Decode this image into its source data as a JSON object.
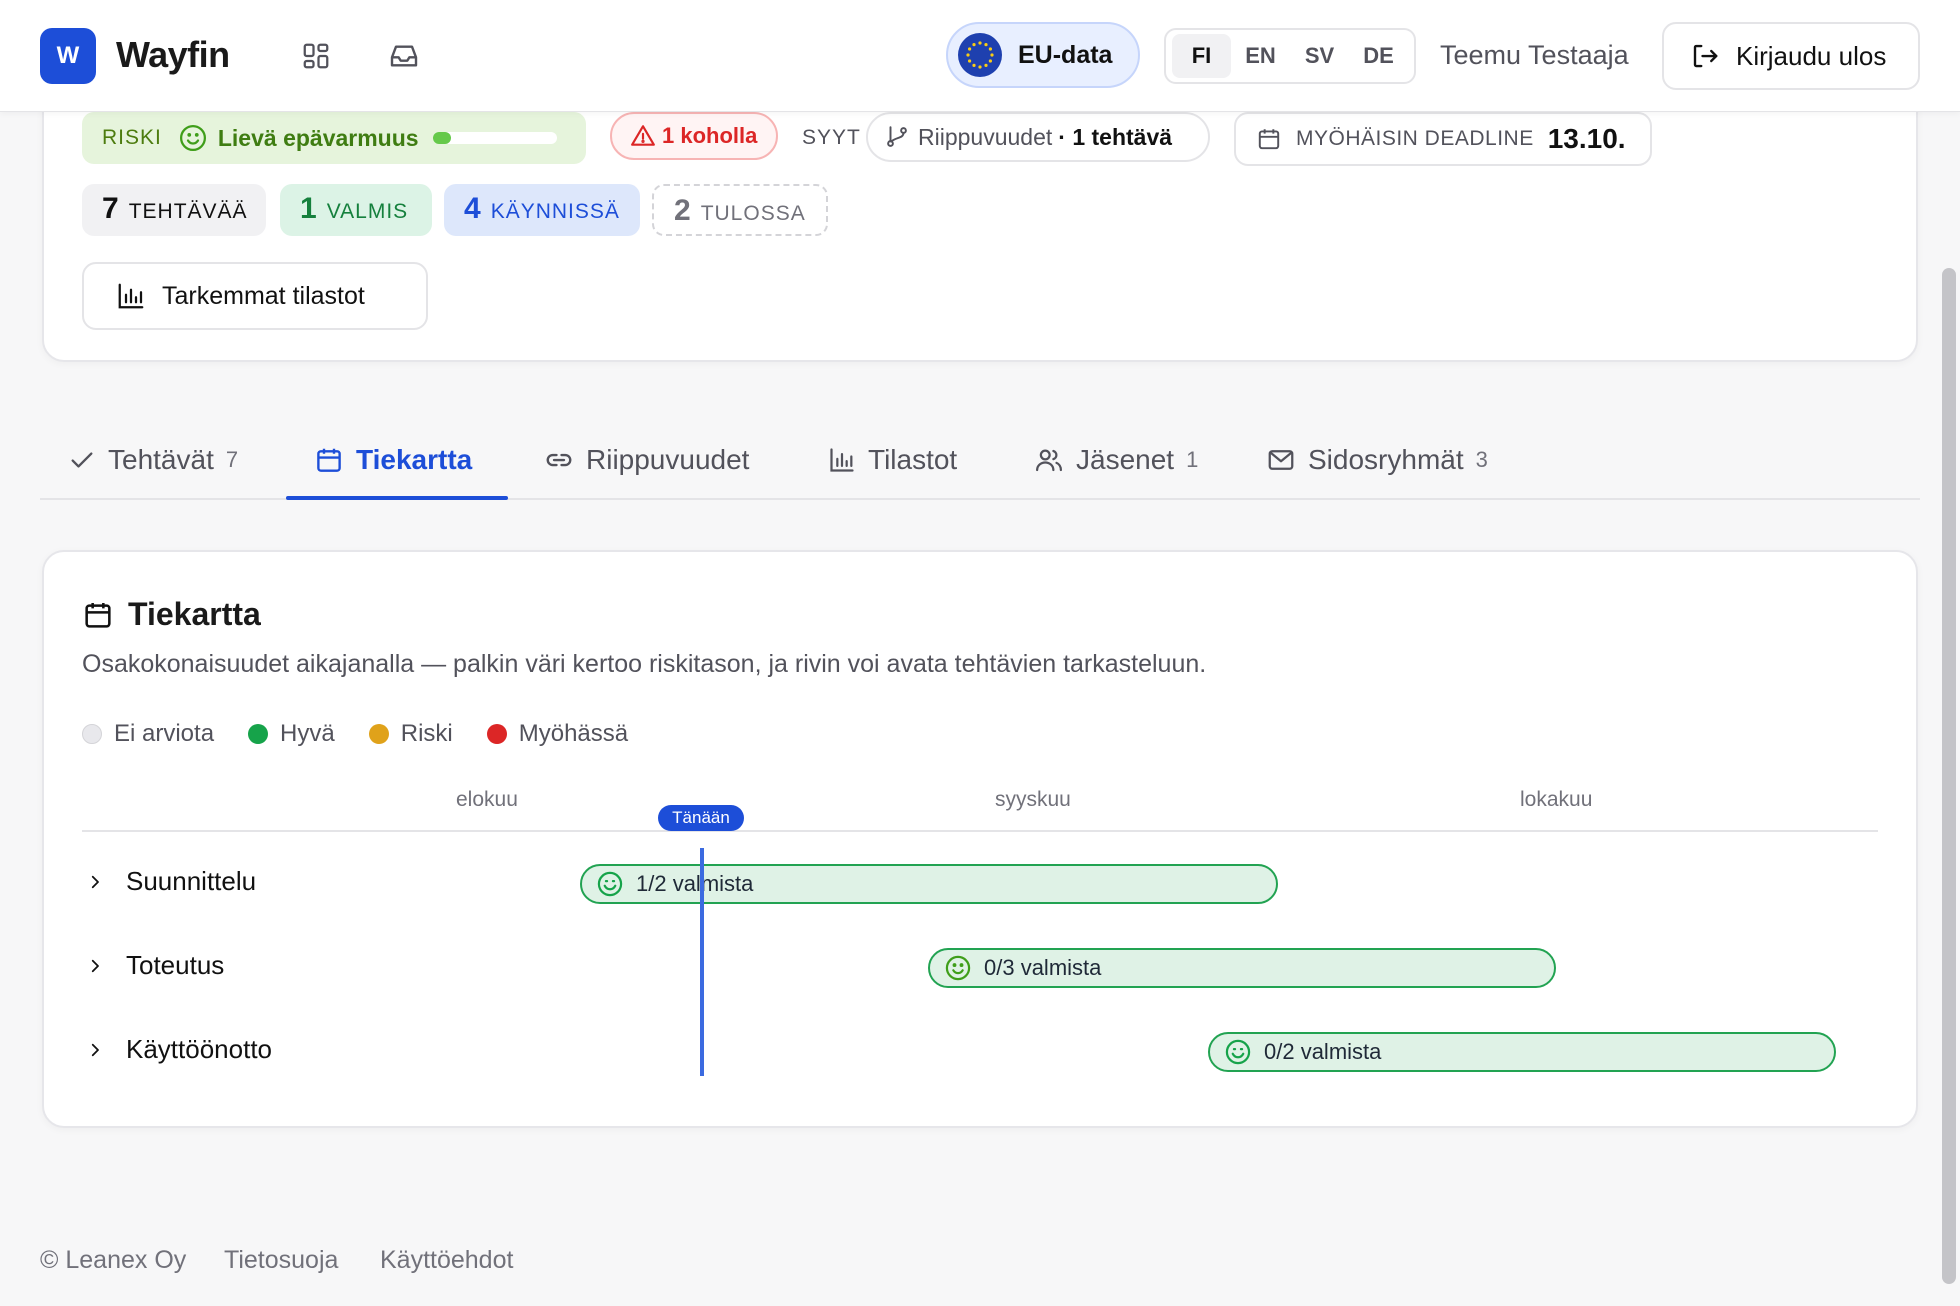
{
  "header": {
    "logo_letter": "W",
    "brand": "Wayfin",
    "icons": [
      "grid-icon",
      "inbox-icon"
    ],
    "eu_badge": "EU-data",
    "languages": [
      "FI",
      "EN",
      "SV",
      "DE"
    ],
    "active_language": "FI",
    "user_name": "Teemu Testaaja",
    "logout_label": "Kirjaudu ulos"
  },
  "summary": {
    "risk_label": "RISKI",
    "risk_text": "Lievä epävarmuus",
    "risk_level_fraction": 0.15,
    "warning": "1 koholla",
    "causes_label": "SYYT",
    "cause_name": "Riippuvuudet",
    "cause_count": "· 1 tehtävä",
    "deadline_label": "MYÖHÄISIN DEADLINE",
    "deadline_value": "13.10.",
    "stats": {
      "total": {
        "num": "7",
        "label": "TEHTÄVÄÄ"
      },
      "done": {
        "num": "1",
        "label": "VALMIS"
      },
      "in_progress": {
        "num": "4",
        "label": "KÄYNNISSÄ"
      },
      "upcoming": {
        "num": "2",
        "label": "TULOSSA"
      }
    },
    "stats_button": "Tarkemmat tilastot"
  },
  "tabs": [
    {
      "label": "Tehtävät",
      "count": "7"
    },
    {
      "label": "Tiekartta",
      "count": ""
    },
    {
      "label": "Riippuvuudet",
      "count": ""
    },
    {
      "label": "Tilastot",
      "count": ""
    },
    {
      "label": "Jäsenet",
      "count": "1"
    },
    {
      "label": "Sidosryhmät",
      "count": "3"
    }
  ],
  "active_tab": "Tiekartta",
  "roadmap": {
    "title": "Tiekartta",
    "description": "Osakokonaisuudet aikajanalla — palkin väri kertoo riskitason, ja rivin voi avata tehtävien tarkasteluun.",
    "legend": [
      {
        "label": "Ei arviota",
        "color": "#e8e8ec"
      },
      {
        "label": "Hyvä",
        "color": "#16a34a"
      },
      {
        "label": "Riski",
        "color": "#e0a21a"
      },
      {
        "label": "Myöhässä",
        "color": "#dc2626"
      }
    ],
    "months": [
      "elokuu",
      "syyskuu",
      "lokakuu"
    ],
    "today_label": "Tänään",
    "rows": [
      {
        "name": "Suunnittelu",
        "progress": "1/2 valmista",
        "status": "Hyvä"
      },
      {
        "name": "Toteutus",
        "progress": "0/3 valmista",
        "status": "Hyvä"
      },
      {
        "name": "Käyttöönotto",
        "progress": "0/2 valmista",
        "status": "Hyvä"
      }
    ]
  },
  "footer": {
    "copyright": "© Leanex Oy",
    "privacy": "Tietosuoja",
    "terms": "Käyttöehdot"
  }
}
